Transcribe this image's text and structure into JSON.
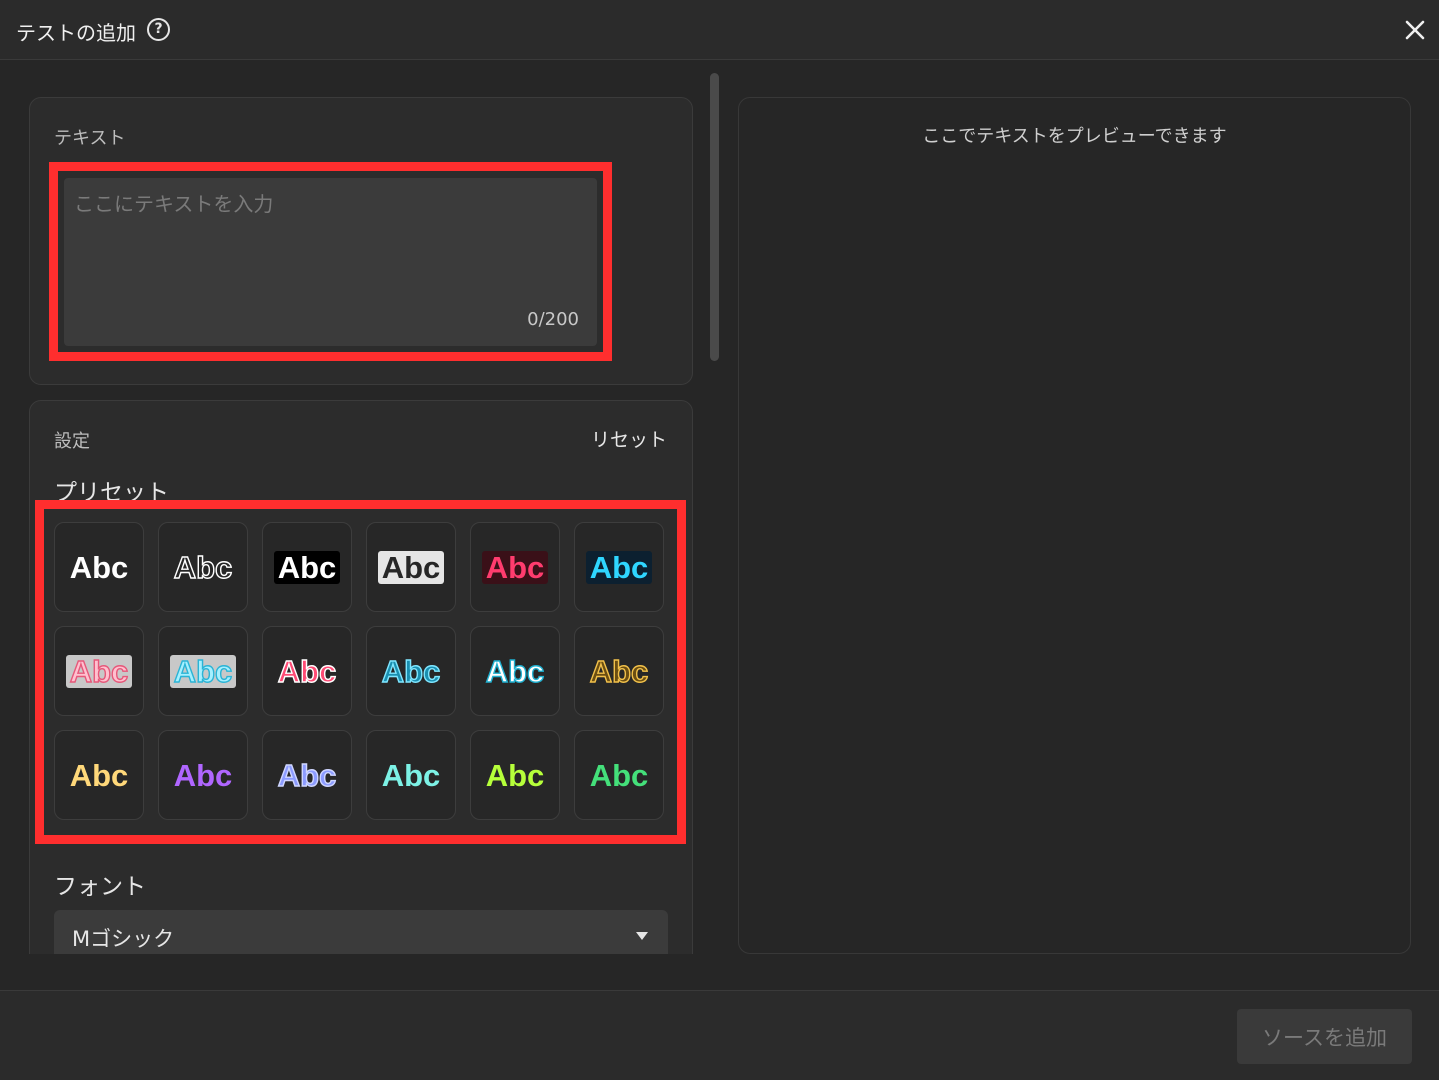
{
  "dialog": {
    "title": "テストの追加",
    "help_icon": "?",
    "close_icon": "close-icon"
  },
  "text_section": {
    "label": "テキスト",
    "placeholder": "ここにテキストを入力",
    "counter": "0/200"
  },
  "settings": {
    "label": "設定",
    "reset_label": "リセット",
    "preset_title": "プリセット",
    "presets": [
      {
        "label": "Abc",
        "color": "#ffffff",
        "bg": "transparent",
        "stroke": "none"
      },
      {
        "label": "Abc",
        "color": "#262626",
        "bg": "transparent",
        "stroke": "#ffffff"
      },
      {
        "label": "Abc",
        "color": "#ffffff",
        "bg": "#000000",
        "stroke": "none"
      },
      {
        "label": "Abc",
        "color": "#262626",
        "bg": "#e5e5e5",
        "stroke": "none"
      },
      {
        "label": "Abc",
        "color": "#ff3c6e",
        "bg": "#3a1018",
        "stroke": "none"
      },
      {
        "label": "Abc",
        "color": "#2fd6ff",
        "bg": "#0c2030",
        "stroke": "none"
      },
      {
        "label": "Abc",
        "color": "#ffc0cf",
        "bg": "#c8c8c8",
        "stroke": "#e6587a"
      },
      {
        "label": "Abc",
        "color": "#a6f0ff",
        "bg": "#c8c8c8",
        "stroke": "#2ab4d6"
      },
      {
        "label": "Abc",
        "color": "#ff4b75",
        "bg": "transparent",
        "stroke": "#ffffff"
      },
      {
        "label": "Abc",
        "color": "#1a8fb0",
        "bg": "transparent",
        "stroke": "#7fe6ff"
      },
      {
        "label": "Abc",
        "color": "#ffffff",
        "bg": "transparent",
        "stroke": "#1fb0d0"
      },
      {
        "label": "Abc",
        "color": "#6b4e12",
        "bg": "transparent",
        "stroke": "#f2c14a"
      },
      {
        "label": "Abc",
        "color": "#ffd87a",
        "bg": "transparent",
        "stroke": "none"
      },
      {
        "label": "Abc",
        "color": "#b066ff",
        "bg": "transparent",
        "stroke": "none"
      },
      {
        "label": "Abc",
        "color": "#8c9bff",
        "bg": "transparent",
        "stroke": "#cfd6ff"
      },
      {
        "label": "Abc",
        "color": "#7df2e6",
        "bg": "transparent",
        "stroke": "none"
      },
      {
        "label": "Abc",
        "color": "#b6ff3a",
        "bg": "transparent",
        "stroke": "none"
      },
      {
        "label": "Abc",
        "color": "#44e07a",
        "bg": "transparent",
        "stroke": "none"
      }
    ],
    "font_title": "フォント",
    "font_value": "Mゴシック"
  },
  "preview": {
    "hint": "ここでテキストをプレビューできます"
  },
  "footer": {
    "add_source_label": "ソースを追加"
  },
  "accents": {
    "highlight": "#ff2e2e"
  }
}
